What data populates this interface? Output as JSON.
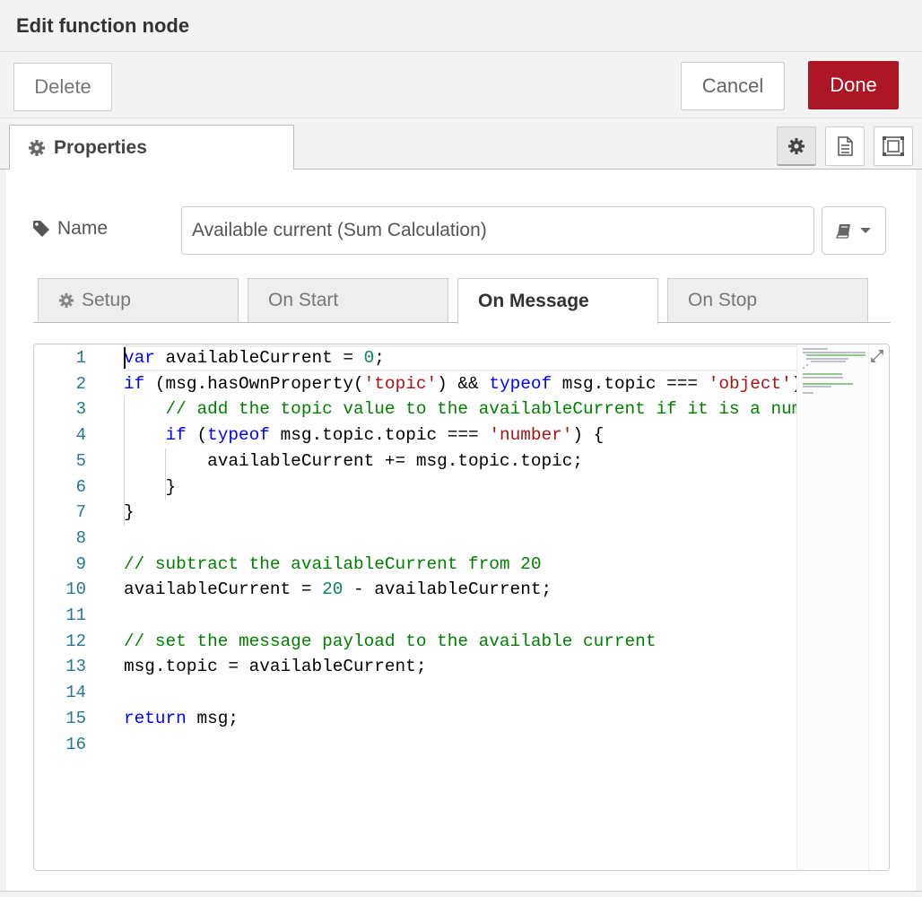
{
  "dialog": {
    "title": "Edit function node"
  },
  "toolbar": {
    "delete_label": "Delete",
    "cancel_label": "Cancel",
    "done_label": "Done",
    "done_color": "#ad1625"
  },
  "tabs": {
    "properties_label": "Properties"
  },
  "node": {
    "name_label": "Name",
    "name_value": "Available current (Sum Calculation)"
  },
  "subtabs": [
    {
      "label": "Setup"
    },
    {
      "label": "On Start"
    },
    {
      "label": "On Message",
      "active": true
    },
    {
      "label": "On Stop"
    }
  ],
  "editor": {
    "line_numbers": [
      "1",
      "2",
      "3",
      "4",
      "5",
      "6",
      "7",
      "8",
      "9",
      "10",
      "11",
      "12",
      "13",
      "14",
      "15",
      "16"
    ],
    "code_lines": [
      "var availableCurrent = 0;",
      "if (msg.hasOwnProperty('topic') && typeof msg.topic === 'object') {",
      "    // add the topic value to the availableCurrent if it is a number",
      "    if (typeof msg.topic.topic === 'number') {",
      "        availableCurrent += msg.topic.topic;",
      "    }",
      "}",
      "",
      "// subtract the availableCurrent from 20",
      "availableCurrent = 20 - availableCurrent;",
      "",
      "// set the message payload to the available current",
      "msg.topic = availableCurrent;",
      "",
      "return msg;",
      ""
    ]
  },
  "icons": {
    "gear": "gear-icon",
    "book": "book-icon",
    "tag": "tag-icon",
    "expand": "expand-icon",
    "description": "document-icon",
    "appearance": "frame-icon"
  }
}
